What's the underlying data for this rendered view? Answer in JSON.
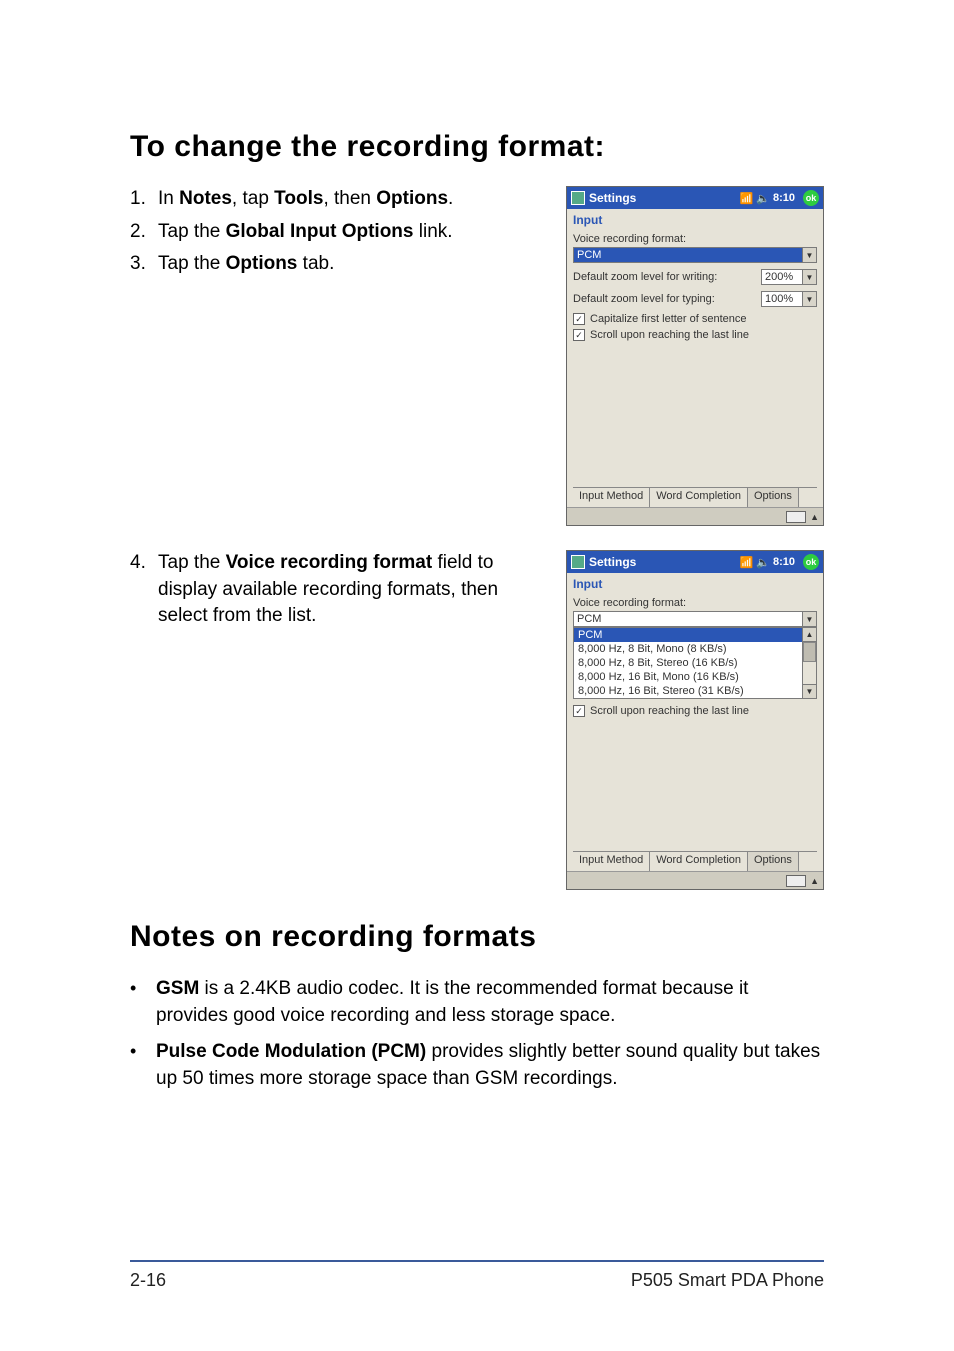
{
  "headings": {
    "h1": "To change the recording format:",
    "h2": "Notes on recording formats"
  },
  "steps": {
    "s1": {
      "num": "1.",
      "pre": "In ",
      "b1": "Notes",
      "mid1": ", tap ",
      "b2": "Tools",
      "mid2": ", then ",
      "b3": "Options",
      "post": "."
    },
    "s2": {
      "num": "2.",
      "pre": "Tap the ",
      "b1": "Global Input Options",
      "post": " link."
    },
    "s3": {
      "num": "3.",
      "pre": "Tap the ",
      "b1": "Options",
      "post": " tab."
    },
    "s4": {
      "num": "4.",
      "pre": "Tap the ",
      "b1": "Voice recording format",
      "post": " field to display available recording formats, then select from the list."
    }
  },
  "notes": {
    "n1": {
      "b": "GSM",
      "text": " is a 2.4KB audio codec. It is the recommended format because it provides good voice recording and less storage space."
    },
    "n2": {
      "b": "Pulse Code Modulation (PCM)",
      "text": " provides slightly better sound quality but takes up 50 times more storage space than GSM recordings."
    }
  },
  "footer": {
    "left": "2-16",
    "right": "P505 Smart PDA Phone"
  },
  "shot1": {
    "title": "Settings",
    "time": "8:10",
    "ok": "ok",
    "panel_title": "Input",
    "vrf_label": "Voice recording format:",
    "vrf_value": "PCM",
    "zoom_writing_label": "Default zoom level for writing:",
    "zoom_writing_value": "200%",
    "zoom_typing_label": "Default zoom level for typing:",
    "zoom_typing_value": "100%",
    "chk1": "Capitalize first letter of sentence",
    "chk2": "Scroll upon reaching the last line",
    "tabs": {
      "t1": "Input Method",
      "t2": "Word Completion",
      "t3": "Options"
    }
  },
  "shot2": {
    "title": "Settings",
    "time": "8:10",
    "ok": "ok",
    "panel_title": "Input",
    "vrf_label": "Voice recording format:",
    "vrf_value": "PCM",
    "options": {
      "o0": "PCM",
      "o1": "8,000 Hz, 8 Bit, Mono (8 KB/s)",
      "o2": "8,000 Hz, 8 Bit, Stereo (16 KB/s)",
      "o3": "8,000 Hz, 16 Bit, Mono (16 KB/s)",
      "o4": "8,000 Hz, 16 Bit, Stereo (31 KB/s)"
    },
    "chk2": "Scroll upon reaching the last line",
    "tabs": {
      "t1": "Input Method",
      "t2": "Word Completion",
      "t3": "Options"
    }
  }
}
